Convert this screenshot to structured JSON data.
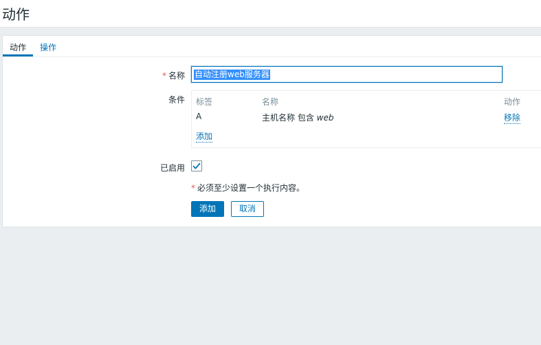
{
  "header": {
    "title": "动作"
  },
  "tabs": [
    {
      "label": "动作",
      "active": true
    },
    {
      "label": "操作",
      "active": false
    }
  ],
  "form": {
    "name_label": "名称",
    "name_required_mark": "*",
    "name_value": "自动注册web服务器",
    "conditions_label": "条件",
    "conditions_table": {
      "headers": [
        "标签",
        "名称",
        "动作"
      ],
      "rows": [
        {
          "tag": "A",
          "name_prefix": "主机名称 包含 ",
          "name_value": "web",
          "action": "移除"
        }
      ],
      "add_label": "添加"
    },
    "enabled_label": "已启用",
    "enabled": true,
    "hint_mark": "*",
    "hint_text": "必须至少设置一个执行内容。"
  },
  "buttons": {
    "add": "添加",
    "cancel": "取消"
  },
  "colors": {
    "accent": "#0275b8",
    "required": "#e45959",
    "background": "#ebeef0",
    "panel": "#ffffff",
    "muted_text": "#768d99"
  }
}
